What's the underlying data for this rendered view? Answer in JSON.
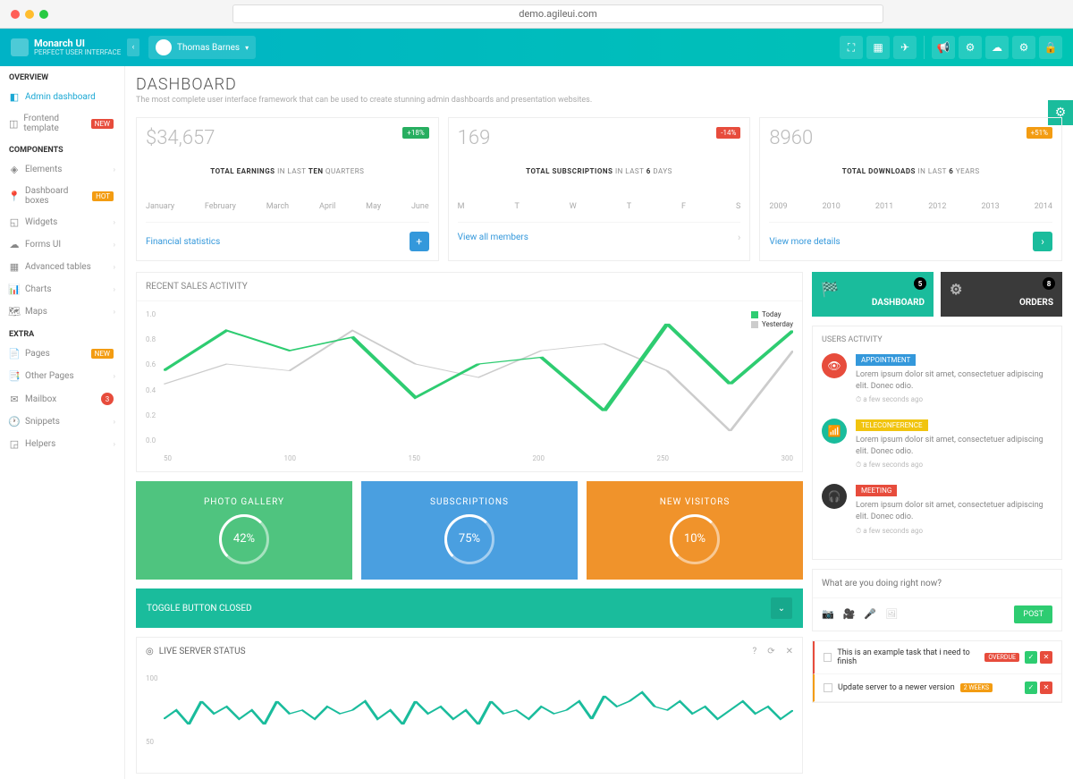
{
  "browser": {
    "url": "demo.agileui.com"
  },
  "brand": {
    "title": "Monarch UI",
    "subtitle": "PERFECT USER INTERFACE"
  },
  "user": {
    "name": "Thomas Barnes"
  },
  "sidebar": {
    "overview": {
      "header": "OVERVIEW",
      "items": [
        {
          "label": "Admin dashboard"
        },
        {
          "label": "Frontend template",
          "badge": "NEW"
        }
      ]
    },
    "components": {
      "header": "COMPONENTS",
      "items": [
        {
          "label": "Elements"
        },
        {
          "label": "Dashboard boxes",
          "badge": "HOT"
        },
        {
          "label": "Widgets"
        },
        {
          "label": "Forms UI"
        },
        {
          "label": "Advanced tables"
        },
        {
          "label": "Charts"
        },
        {
          "label": "Maps"
        }
      ]
    },
    "extra": {
      "header": "EXTRA",
      "items": [
        {
          "label": "Pages",
          "badge": "NEW"
        },
        {
          "label": "Other Pages"
        },
        {
          "label": "Mailbox",
          "count": "3"
        },
        {
          "label": "Snippets"
        },
        {
          "label": "Helpers"
        }
      ]
    }
  },
  "page": {
    "title": "DASHBOARD",
    "subtitle": "The most complete user interface framework that can be used to create stunning admin dashboards and presentation websites."
  },
  "stats": [
    {
      "value": "$34,657",
      "delta": "+18%",
      "deltaColor": "green",
      "label_pre": "TOTAL EARNINGS",
      "label_mid": " IN LAST ",
      "label_bold": "TEN",
      "label_post": " QUARTERS",
      "axis": [
        "January",
        "February",
        "March",
        "April",
        "May",
        "June"
      ],
      "link": "Financial statistics",
      "btn": "+"
    },
    {
      "value": "169",
      "delta": "-14%",
      "deltaColor": "red",
      "label_pre": "TOTAL SUBSCRIPTIONS",
      "label_mid": " IN LAST ",
      "label_bold": "6",
      "label_post": " DAYS",
      "axis": [
        "M",
        "T",
        "W",
        "T",
        "F",
        "S"
      ],
      "link": "View all members",
      "btn": "›"
    },
    {
      "value": "8960",
      "delta": "+51%",
      "deltaColor": "orange",
      "label_pre": "TOTAL DOWNLOADS",
      "label_mid": " IN LAST ",
      "label_bold": "6",
      "label_post": " YEARS",
      "axis": [
        "2009",
        "2010",
        "2011",
        "2012",
        "2013",
        "2014"
      ],
      "link": "View more details",
      "btn": "›"
    }
  ],
  "salesChart": {
    "title": "RECENT SALES ACTIVITY",
    "legend": [
      {
        "label": "Today",
        "color": "#2ecc71"
      },
      {
        "label": "Yesterday",
        "color": "#ccc"
      }
    ],
    "yTicks": [
      "1.0",
      "0.8",
      "0.6",
      "0.4",
      "0.2",
      "0.0"
    ],
    "xTicks": [
      "50",
      "100",
      "150",
      "200",
      "250",
      "300"
    ]
  },
  "chart_data": {
    "type": "line",
    "x": [
      50,
      100,
      150,
      200,
      250,
      300
    ],
    "ylim": [
      0,
      1.0
    ],
    "series": [
      {
        "name": "Today",
        "color": "#2ecc71",
        "values": [
          0.55,
          0.85,
          0.7,
          0.8,
          0.35,
          0.6,
          0.65,
          0.25,
          0.9,
          0.45,
          0.85
        ]
      },
      {
        "name": "Yesterday",
        "color": "#cccccc",
        "values": [
          0.45,
          0.6,
          0.55,
          0.85,
          0.6,
          0.5,
          0.7,
          0.75,
          0.55,
          0.1,
          0.7
        ]
      }
    ]
  },
  "tiles": [
    {
      "title": "PHOTO GALLERY",
      "value": "42%",
      "color": "green"
    },
    {
      "title": "SUBSCRIPTIONS",
      "value": "75%",
      "color": "blue"
    },
    {
      "title": "NEW VISITORS",
      "value": "10%",
      "color": "orange"
    }
  ],
  "toggle": {
    "label": "TOGGLE BUTTON CLOSED"
  },
  "server": {
    "title": "LIVE SERVER STATUS",
    "yTicks": [
      "100",
      "50"
    ]
  },
  "tabs": [
    {
      "label": "DASHBOARD",
      "count": "5",
      "color": "teal"
    },
    {
      "label": "ORDERS",
      "count": "8",
      "color": "dark"
    }
  ],
  "activity": {
    "title": "USERS ACTIVITY",
    "items": [
      {
        "tag": "APPOINTMENT",
        "tagColor": "blue",
        "icon": "red",
        "text": "Lorem ipsum dolor sit amet, consectetuer adipiscing elit. Donec odio.",
        "time": "a few seconds ago"
      },
      {
        "tag": "TELECONFERENCE",
        "tagColor": "yellow",
        "icon": "teal",
        "text": "Lorem ipsum dolor sit amet, consectetuer adipiscing elit. Donec odio.",
        "time": "a few seconds ago"
      },
      {
        "tag": "MEETING",
        "tagColor": "red",
        "icon": "dark",
        "text": "Lorem ipsum dolor sit amet, consectetuer adipiscing elit. Donec odio.",
        "time": "a few seconds ago"
      }
    ]
  },
  "compose": {
    "placeholder": "What are you doing right now?",
    "post": "POST"
  },
  "tasks": [
    {
      "text": "This is an example task that i need to finish",
      "badge": "OVERDUE",
      "badgeColor": "red",
      "border": "red"
    },
    {
      "text": "Update server to a newer version",
      "badge": "2 WEEKS",
      "badgeColor": "orange",
      "border": "orange"
    }
  ]
}
